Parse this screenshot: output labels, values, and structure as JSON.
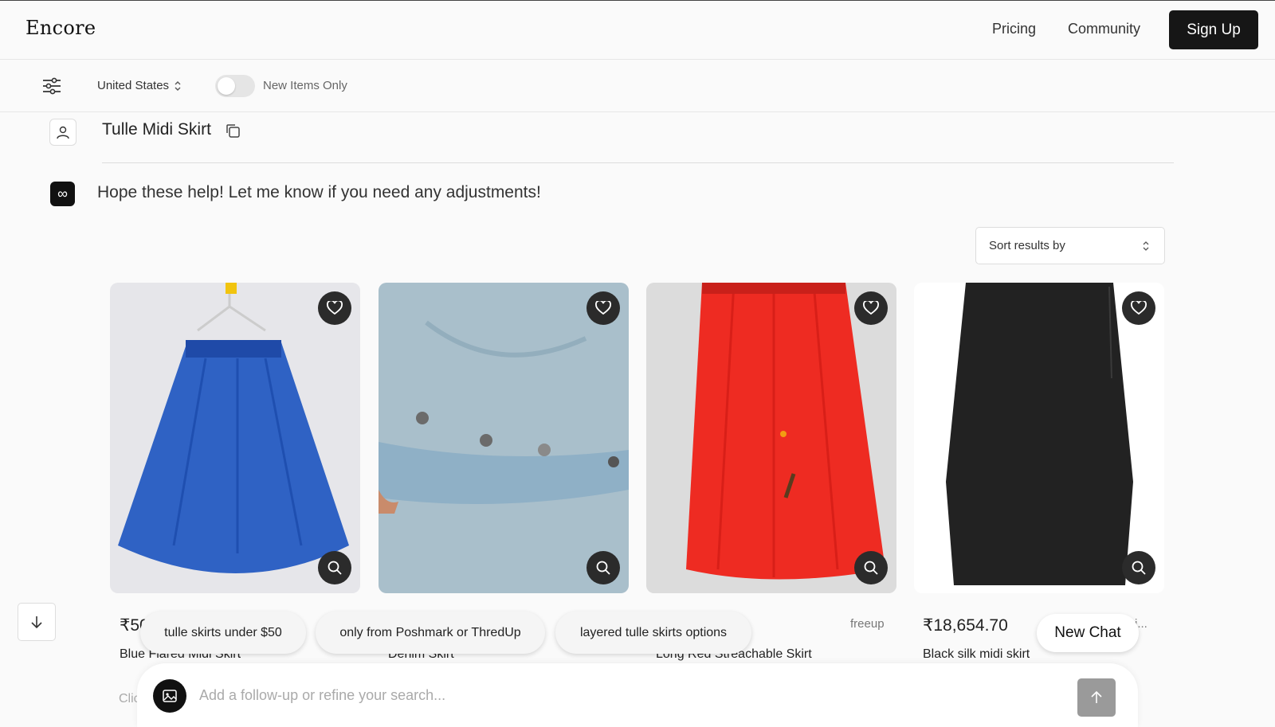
{
  "header": {
    "logo": "Encore",
    "nav": [
      "Pricing",
      "Community"
    ],
    "signup_label": "Sign Up"
  },
  "filters": {
    "country": "United States",
    "toggle_label": "New Items Only",
    "toggle_on": false
  },
  "conversation": {
    "user_query": "Tulle Midi Skirt",
    "bot_message": "Hope these help! Let me know if you need any adjustments!"
  },
  "sort": {
    "label": "Sort results by"
  },
  "products": [
    {
      "price": "₹50",
      "title": "Blue Flared Midi Skirt",
      "seller": "",
      "image_color": "#2f62c4"
    },
    {
      "price": "",
      "title": "Denim Skirt",
      "seller": "",
      "image_color": "#a9bfcb"
    },
    {
      "price": "",
      "title": "Long Red Streachable Skirt",
      "seller": "freeup",
      "image_color": "#ee2b22"
    },
    {
      "price": "₹18,654.70",
      "title": "Black silk midi skirt",
      "seller": "i...",
      "image_color": "#222222"
    }
  ],
  "suggestions": [
    "tulle skirts under $50",
    "only from Poshmark or ThredUp",
    "layered tulle skirts options"
  ],
  "new_chat_label": "New Chat",
  "composer": {
    "placeholder": "Add a follow-up or refine your search...",
    "hint_fragment": "Clic"
  }
}
